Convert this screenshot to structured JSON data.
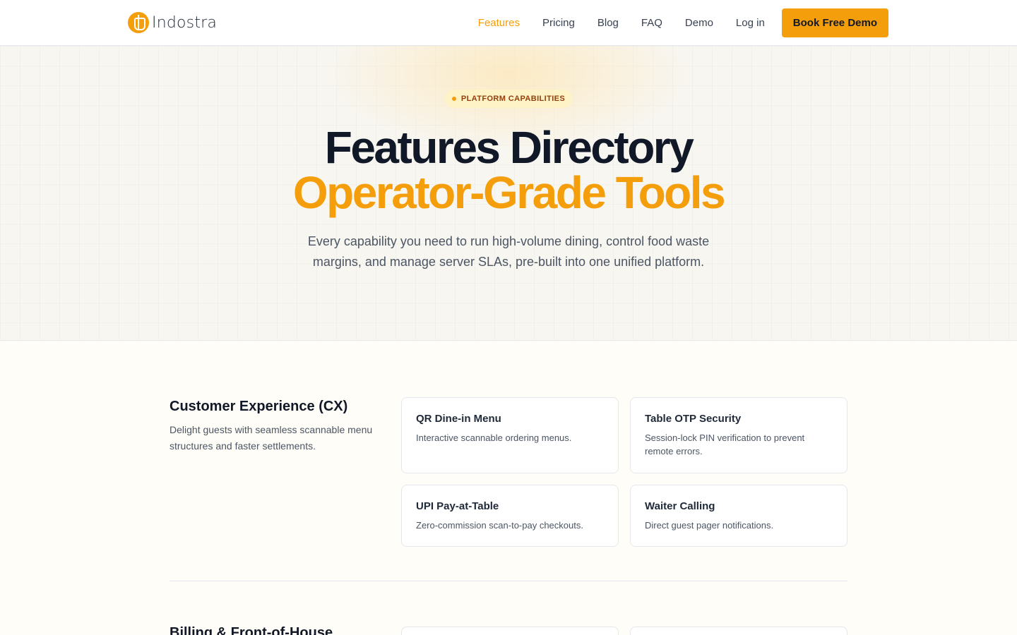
{
  "brand": {
    "name": "Indostra"
  },
  "nav": {
    "links": [
      "Features",
      "Pricing",
      "Blog",
      "FAQ",
      "Demo",
      "Log in"
    ],
    "cta": "Book Free Demo"
  },
  "hero": {
    "badge": "PLATFORM CAPABILITIES",
    "title": "Features Directory",
    "title_highlight": "Operator-Grade Tools",
    "subtitle": "Every capability you need to run high-volume dining, control food waste margins, and manage server SLAs, pre-built into one unified platform."
  },
  "sections": [
    {
      "title": "Customer Experience (CX)",
      "description": "Delight guests with seamless scannable menu structures and faster settlements.",
      "cards": [
        {
          "title": "QR Dine-in Menu",
          "description": "Interactive scannable ordering menus."
        },
        {
          "title": "Table OTP Security",
          "description": "Session-lock PIN verification to prevent remote errors."
        },
        {
          "title": "UPI Pay-at-Table",
          "description": "Zero-commission scan-to-pay checkouts."
        },
        {
          "title": "Waiter Calling",
          "description": "Direct guest pager notifications."
        }
      ]
    },
    {
      "title": "Billing & Front-of-House"
    }
  ],
  "colors": {
    "accent": "#f59e0b",
    "text": "#111827",
    "muted": "#4b5563",
    "badge_bg": "#fef3c7"
  }
}
